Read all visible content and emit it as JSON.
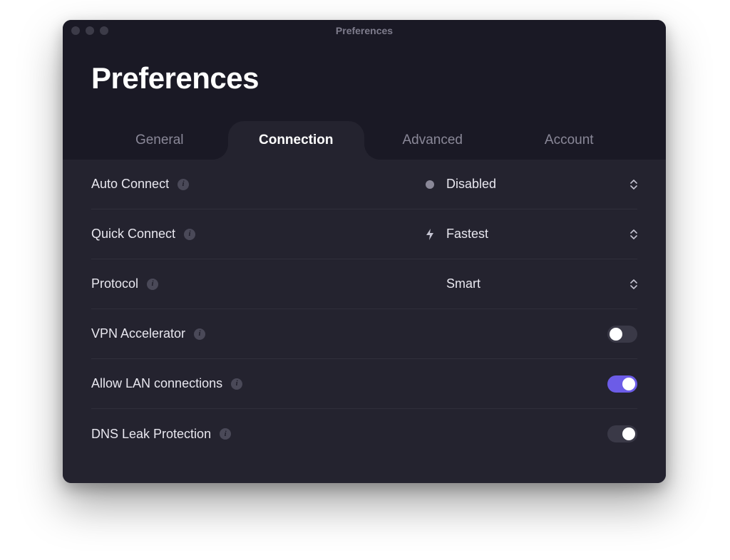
{
  "window": {
    "title": "Preferences"
  },
  "page": {
    "title": "Preferences"
  },
  "tabs": [
    {
      "label": "General"
    },
    {
      "label": "Connection"
    },
    {
      "label": "Advanced"
    },
    {
      "label": "Account"
    }
  ],
  "active_tab_index": 1,
  "accent_color": "#6c5ce7",
  "settings": {
    "auto_connect": {
      "label": "Auto Connect",
      "value": "Disabled",
      "icon": "dot"
    },
    "quick_connect": {
      "label": "Quick Connect",
      "value": "Fastest",
      "icon": "bolt"
    },
    "protocol": {
      "label": "Protocol",
      "value": "Smart",
      "icon": ""
    },
    "vpn_accel": {
      "label": "VPN Accelerator",
      "on": false,
      "style": "off"
    },
    "allow_lan": {
      "label": "Allow LAN connections",
      "on": true,
      "style": "accent"
    },
    "dns_leak": {
      "label": "DNS Leak Protection",
      "on": true,
      "style": "dark"
    }
  }
}
